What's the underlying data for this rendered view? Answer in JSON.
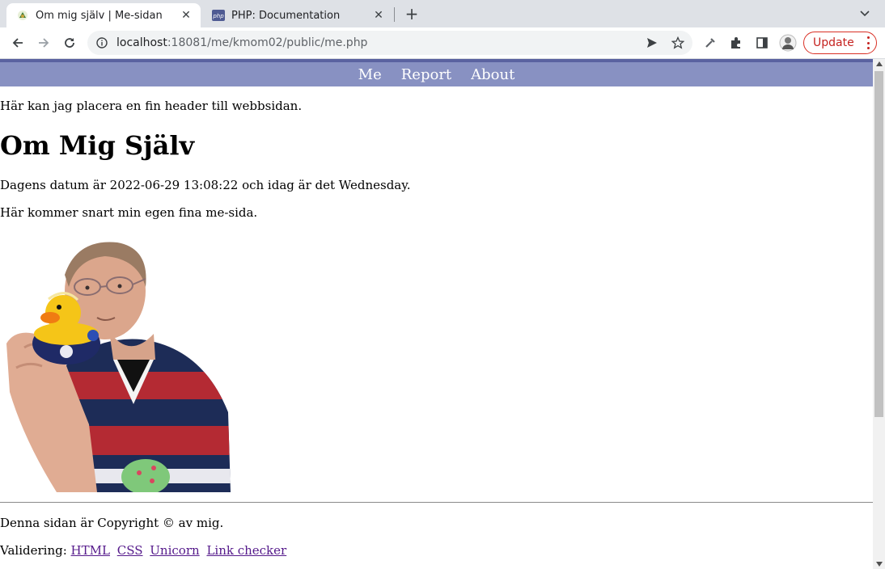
{
  "browser": {
    "tabs": [
      {
        "title": "Om mig själv | Me-sidan",
        "icon": "leaf-favicon-icon",
        "active": true
      },
      {
        "title": "PHP: Documentation",
        "icon": "php-favicon-icon",
        "active": false
      }
    ],
    "php_favicon_text": "php",
    "url_host": "localhost",
    "url_path": ":18081/me/kmom02/public/me.php",
    "update_label": "Update",
    "colors": {
      "update": "#d93025",
      "tabbar": "#dee1e6"
    }
  },
  "page": {
    "nav": [
      "Me",
      "Report",
      "About"
    ],
    "header_text": "Här kan jag placera en fin header till webbsidan.",
    "title": "Om Mig Själv",
    "date_text": "Dagens datum är 2022-06-29 13:08:22 och idag är det Wednesday.",
    "intro_text": "Här kommer snart min egen fina me-sida.",
    "photo": "person-holding-rubber-duck",
    "footer_copyright": "Denna sidan är Copyright © av mig.",
    "validation_label": "Validering:",
    "validation_links": [
      "HTML",
      "CSS",
      "Unicorn",
      "Link checker"
    ],
    "colors": {
      "nav_bg": "#8891c2",
      "nav_top": "#5a62a0",
      "link": "#551a8b"
    }
  }
}
